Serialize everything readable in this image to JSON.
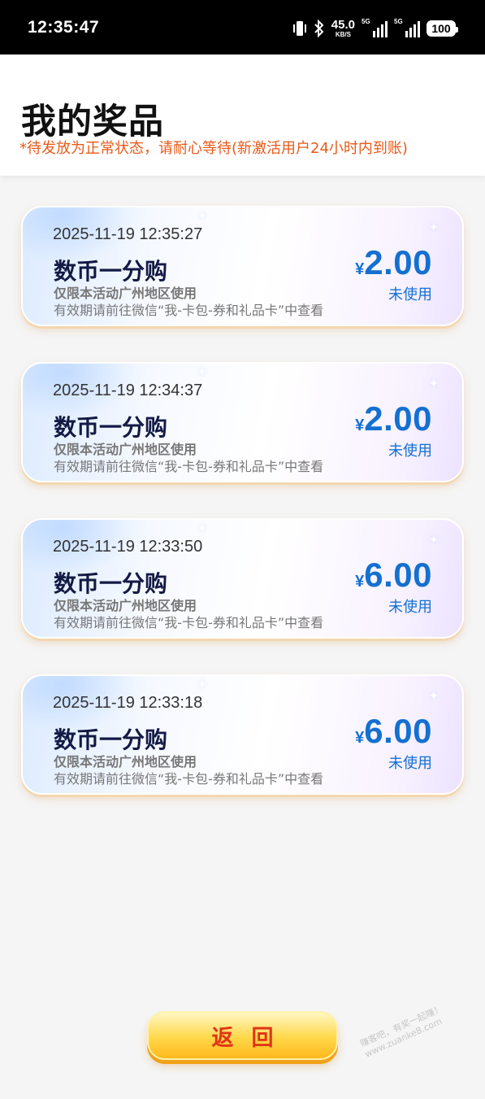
{
  "status_bar": {
    "time": "12:35:47",
    "net_speed": "45.0",
    "net_speed_unit": "KB/S",
    "signal_label_1": "5G",
    "signal_label_2": "5G",
    "battery": "100"
  },
  "header": {
    "title": "我的奖品",
    "notice": "*待发放为正常状态，请耐心等待(新激活用户24小时内到账)"
  },
  "prizes": [
    {
      "date": "2025-11-19 12:35:27",
      "name": "数币一分购",
      "limit": "仅限本活动广州地区使用",
      "validity": "有效期请前往微信“我-卡包-券和礼品卡”中查看",
      "currency": "¥",
      "amount": "2.00",
      "status": "未使用"
    },
    {
      "date": "2025-11-19 12:34:37",
      "name": "数币一分购",
      "limit": "仅限本活动广州地区使用",
      "validity": "有效期请前往微信“我-卡包-券和礼品卡”中查看",
      "currency": "¥",
      "amount": "2.00",
      "status": "未使用"
    },
    {
      "date": "2025-11-19 12:33:50",
      "name": "数币一分购",
      "limit": "仅限本活动广州地区使用",
      "validity": "有效期请前往微信“我-卡包-券和礼品卡”中查看",
      "currency": "¥",
      "amount": "6.00",
      "status": "未使用"
    },
    {
      "date": "2025-11-19 12:33:18",
      "name": "数币一分购",
      "limit": "仅限本活动广州地区使用",
      "validity": "有效期请前往微信“我-卡包-券和礼品卡”中查看",
      "currency": "¥",
      "amount": "6.00",
      "status": "未使用"
    }
  ],
  "back_button": {
    "label": "返回"
  },
  "watermark": {
    "line1": "赚客吧，有奖一起赚！",
    "line2": "www.zuanke8.com"
  },
  "colors": {
    "accent": "#1470d0",
    "notice": "#e85a1a",
    "button_text": "#e03418"
  }
}
